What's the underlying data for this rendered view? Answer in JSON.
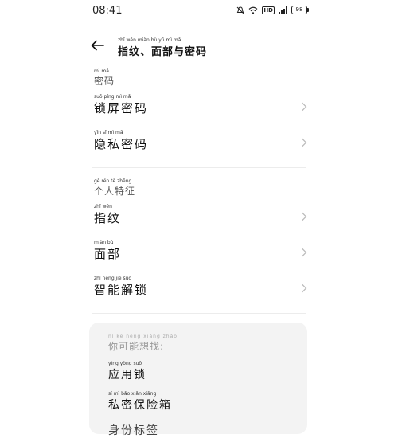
{
  "status_bar": {
    "time": "08:41",
    "battery": "98"
  },
  "header": {
    "title": "指纹、面部与密码",
    "title_pinyin": "zhǐ wén miàn bù yǔ mì mǎ"
  },
  "sections": [
    {
      "title": "密码",
      "title_pinyin": "mì mǎ",
      "items": [
        {
          "label": "锁屏密码",
          "pinyin": "suǒ píng mì mǎ"
        },
        {
          "label": "隐私密码",
          "pinyin": "yǐn sī mì mǎ"
        }
      ]
    },
    {
      "title": "个人特征",
      "title_pinyin": "gè rén tè zhēng",
      "items": [
        {
          "label": "指纹",
          "pinyin": "zhǐ wén"
        },
        {
          "label": "面部",
          "pinyin": "miàn bù"
        },
        {
          "label": "智能解锁",
          "pinyin": "zhì néng jiě suǒ"
        }
      ]
    }
  ],
  "suggestions": {
    "title": "你可能想找:",
    "title_pinyin": "nǐ kě néng xiǎng zhǎo",
    "items": [
      {
        "label": "应用锁",
        "pinyin": "yìng yòng suǒ"
      },
      {
        "label": "私密保险箱",
        "pinyin": "sī mì bǎo xiǎn xiāng"
      },
      {
        "label": "身份标签",
        "pinyin": ""
      }
    ]
  }
}
